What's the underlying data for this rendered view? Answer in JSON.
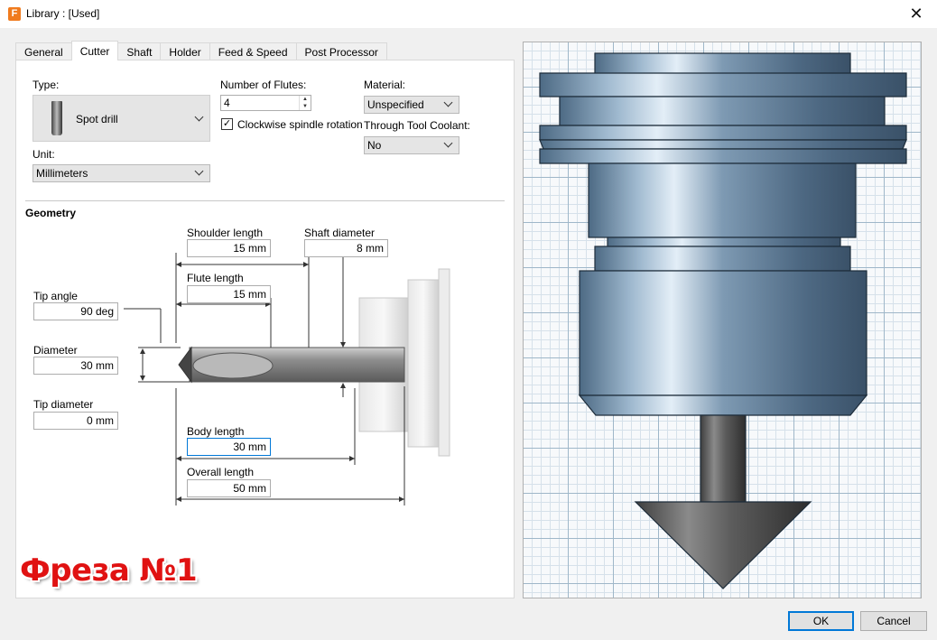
{
  "window": {
    "app_icon": "F",
    "title": "Library : [Used]",
    "close_glyph": "✕"
  },
  "tabs": [
    {
      "label": "General"
    },
    {
      "label": "Cutter"
    },
    {
      "label": "Shaft"
    },
    {
      "label": "Holder"
    },
    {
      "label": "Feed & Speed"
    },
    {
      "label": "Post Processor"
    }
  ],
  "active_tab": "Cutter",
  "cutter": {
    "type_label": "Type:",
    "type_value": "Spot drill",
    "unit_label": "Unit:",
    "unit_value": "Millimeters",
    "flutes_label": "Number of Flutes:",
    "flutes_value": "4",
    "spindle_label": "Clockwise spindle rotation",
    "spindle_checked": true,
    "material_label": "Material:",
    "material_value": "Unspecified",
    "coolant_label": "Through Tool Coolant:",
    "coolant_value": "No"
  },
  "geometry": {
    "heading": "Geometry",
    "shoulder_length": {
      "label": "Shoulder length",
      "value": "15 mm"
    },
    "shaft_diameter": {
      "label": "Shaft diameter",
      "value": "8 mm"
    },
    "flute_length": {
      "label": "Flute length",
      "value": "15 mm"
    },
    "tip_angle": {
      "label": "Tip angle",
      "value": "90 deg"
    },
    "diameter": {
      "label": "Diameter",
      "value": "30 mm"
    },
    "tip_diameter": {
      "label": "Tip diameter",
      "value": "0 mm"
    },
    "body_length": {
      "label": "Body length",
      "value": "30 mm"
    },
    "overall_length": {
      "label": "Overall length",
      "value": "50 mm"
    }
  },
  "caption": "Фреза №1",
  "buttons": {
    "ok": "OK",
    "cancel": "Cancel"
  },
  "icons": {
    "app": "fusion-app-icon",
    "check": "✓",
    "spin_up": "▲",
    "spin_down": "▼"
  }
}
